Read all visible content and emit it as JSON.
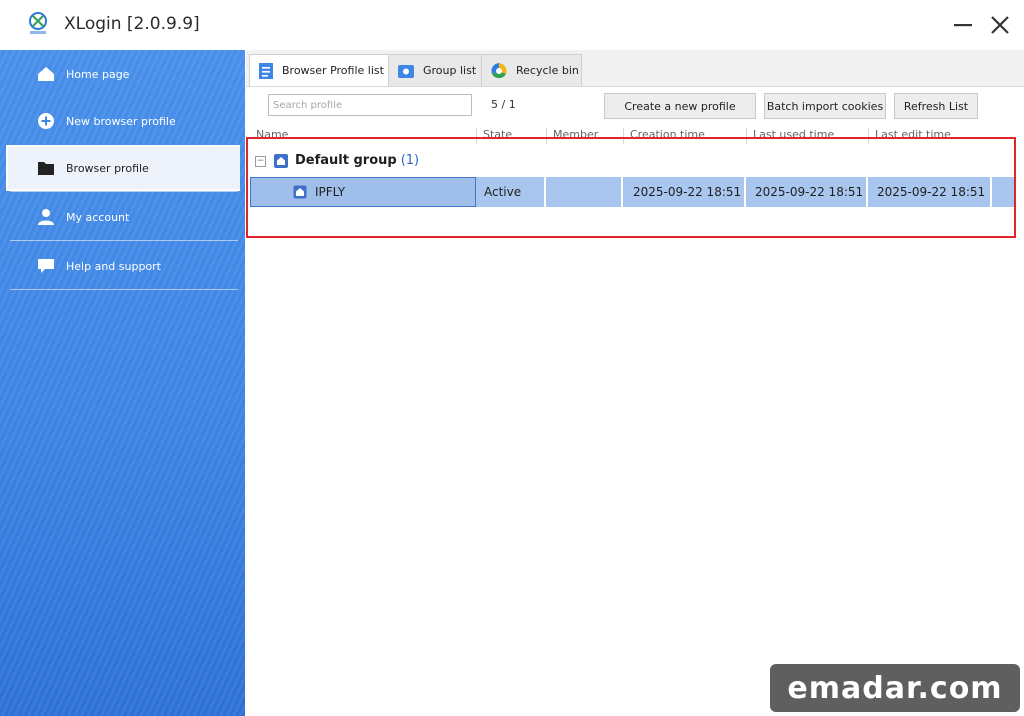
{
  "window": {
    "title": "XLogin [2.0.9.9]",
    "logo_caption": "XLogin"
  },
  "sidebar": {
    "items": [
      {
        "label": "Home page",
        "icon": "home-icon"
      },
      {
        "label": "New browser profile",
        "icon": "plus-circle-icon"
      },
      {
        "label": "Browser profile",
        "icon": "folder-icon",
        "active": true
      },
      {
        "label": "My account",
        "icon": "user-icon"
      },
      {
        "label": "Help and support",
        "icon": "chat-icon"
      }
    ]
  },
  "tabs": [
    {
      "label": "Browser Profile list",
      "icon": "list-icon",
      "active": true
    },
    {
      "label": "Group list",
      "icon": "group-icon"
    },
    {
      "label": "Recycle bin",
      "icon": "recycle-icon"
    }
  ],
  "toolbar": {
    "search_placeholder": "Search profile",
    "pager": "5 / 1",
    "create_label": "Create a new profile",
    "import_label": "Batch import cookies",
    "refresh_label": "Refresh List"
  },
  "table": {
    "columns": [
      "Name",
      "State",
      "Member",
      "Creation time",
      "Last used time",
      "Last edit time"
    ],
    "group": {
      "name": "Default group",
      "count": "(1)"
    },
    "rows": [
      {
        "name": "IPFLY",
        "state": "Active",
        "member": "",
        "created": "2025-09-22 18:51",
        "last_used": "2025-09-22 18:51",
        "last_edit": "2025-09-22 18:51"
      }
    ]
  },
  "watermark": "emadar.com",
  "colors": {
    "sidebar": "#3f86e6",
    "selection": "#a9c6ee",
    "highlight": "#e0262a",
    "group_count": "#2f67c7"
  }
}
